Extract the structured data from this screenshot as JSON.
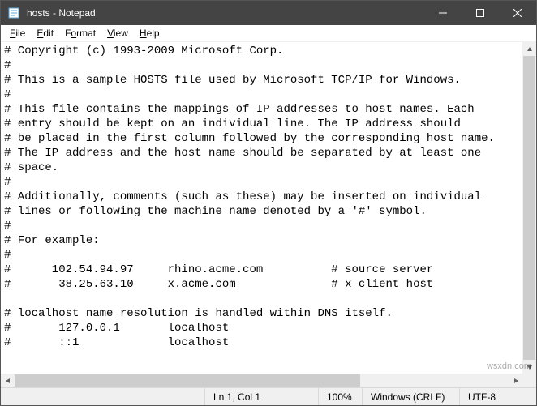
{
  "window": {
    "title": "hosts - Notepad"
  },
  "menu": {
    "file": "File",
    "edit": "Edit",
    "format": "Format",
    "view": "View",
    "help": "Help"
  },
  "content": "# Copyright (c) 1993-2009 Microsoft Corp.\n#\n# This is a sample HOSTS file used by Microsoft TCP/IP for Windows.\n#\n# This file contains the mappings of IP addresses to host names. Each\n# entry should be kept on an individual line. The IP address should\n# be placed in the first column followed by the corresponding host name.\n# The IP address and the host name should be separated by at least one\n# space.\n#\n# Additionally, comments (such as these) may be inserted on individual\n# lines or following the machine name denoted by a '#' symbol.\n#\n# For example:\n#\n#      102.54.94.97     rhino.acme.com          # source server\n#       38.25.63.10     x.acme.com              # x client host\n\n# localhost name resolution is handled within DNS itself.\n#       127.0.0.1       localhost\n#       ::1             localhost",
  "status": {
    "position": "Ln 1, Col 1",
    "zoom": "100%",
    "line_ending": "Windows (CRLF)",
    "encoding": "UTF-8"
  },
  "watermark": "wsxdn.com"
}
